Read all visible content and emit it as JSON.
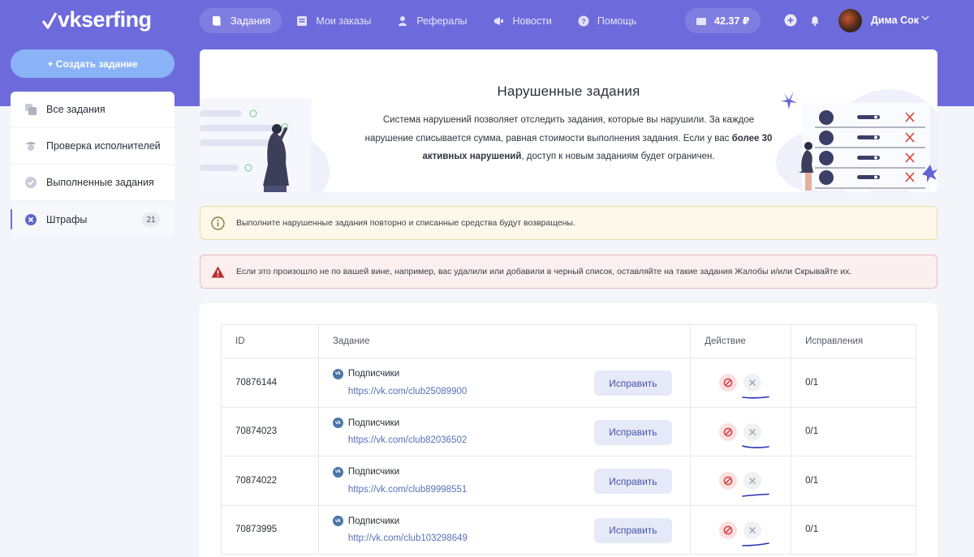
{
  "header": {
    "logo": "vkserfing",
    "nav": [
      {
        "label": "Задания",
        "icon": "tasks-icon",
        "active": true
      },
      {
        "label": "Мои заказы",
        "icon": "orders-icon",
        "active": false
      },
      {
        "label": "Рефералы",
        "icon": "referrals-icon",
        "active": false
      },
      {
        "label": "Новости",
        "icon": "news-icon",
        "active": false
      },
      {
        "label": "Помощь",
        "icon": "help-icon",
        "active": false
      }
    ],
    "balance": "42.37 ₽",
    "username": "Дима Сок"
  },
  "sidebar": {
    "create_label": "+ Создать задание",
    "items": [
      {
        "label": "Все задания",
        "icon": "all-tasks-icon"
      },
      {
        "label": "Проверка исполнителей",
        "icon": "inspector-icon"
      },
      {
        "label": "Выполненные задания",
        "icon": "check-circle-icon"
      },
      {
        "label": "Штрафы",
        "icon": "fines-icon",
        "count": "21",
        "active": true
      }
    ]
  },
  "hero": {
    "title": "Нарушенные задания",
    "text_1": "Система нарушений позволяет отследить задания, которые вы нарушили. За каждое нарушение списывается сумма, равная стоимости выполнения задания. Если у вас ",
    "text_bold": "более 30 активных нарушений",
    "text_2": ", доступ к новым заданиям будет ограничен."
  },
  "alerts": {
    "warning": "Выполните нарушенные задания повторно и списанные средства будут возвращены.",
    "danger": "Если это произошло не по вашей вине, например, вас удалили или добавили в черный список, оставляйте на такие задания Жалобы и/или Скрывайте их."
  },
  "table": {
    "headers": {
      "id": "ID",
      "task": "Задание",
      "action": "Действие",
      "fixes": "Исправления"
    },
    "fix_label": "Исправить",
    "rows": [
      {
        "id": "70876144",
        "type": "Подписчики",
        "link": "https://vk.com/club25089900",
        "fixes": "0/1"
      },
      {
        "id": "70874023",
        "type": "Подписчики",
        "link": "https://vk.com/club82036502",
        "fixes": "0/1"
      },
      {
        "id": "70874022",
        "type": "Подписчики",
        "link": "https://vk.com/club89998551",
        "fixes": "0/1"
      },
      {
        "id": "70873995",
        "type": "Подписчики",
        "link": "http://vk.com/club103298649",
        "fixes": "0/1"
      }
    ]
  },
  "colors": {
    "header": "#6d6bdc",
    "accent": "#6b72d8",
    "link": "#5572b4",
    "danger": "#c0392b"
  }
}
